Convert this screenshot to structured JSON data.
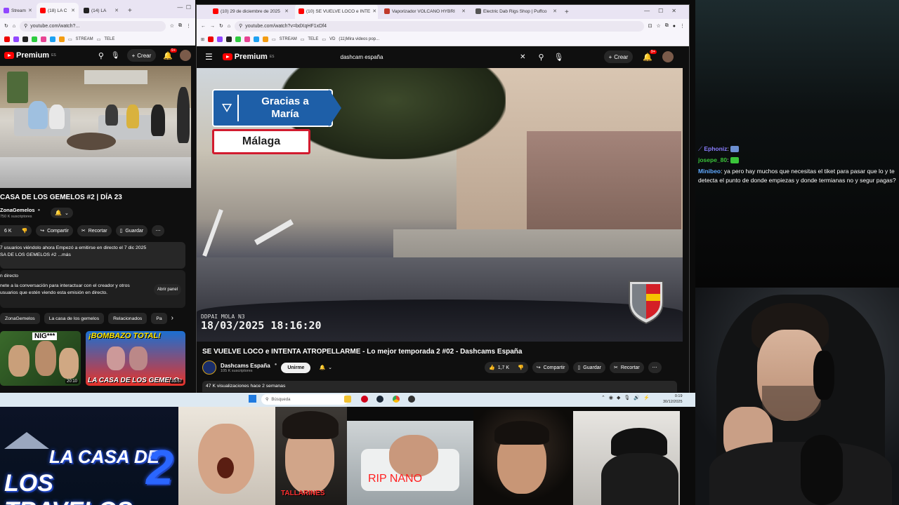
{
  "left_browser": {
    "tabs": [
      {
        "label": "Stream",
        "favicon_color": "#9146ff"
      },
      {
        "label": "(18) LA C",
        "favicon_color": "#ff0000"
      },
      {
        "label": "(14) LA",
        "favicon_color": "#222222"
      }
    ],
    "url": "youtube.com/watch?...",
    "bookmarks": [
      "STREAM",
      "TELE"
    ],
    "youtube": {
      "logo": "Premium",
      "logo_sup": "ES",
      "create_label": "Crear",
      "notif_count": "9+",
      "video_title": "CASA DE LOS GEMELOS #2 | DÍA 23",
      "channel": "ZonaGemelos",
      "subscribers": "750 K suscriptores",
      "likes": "6 K",
      "share_label": "Compartir",
      "clip_label": "Recortar",
      "save_label": "Guardar",
      "description_line1": "7 usuarios viéndolo ahora  Empezó a emitirse en directo el 7 dic 2025",
      "description_line2": "SA DE LOS GEMELOS #2 ...más",
      "live_heading": "n directo",
      "live_line1": "nete a la conversación para interactuar con el creador y otros",
      "live_line2": "usuarios que estén viendo esta emisión en directo.",
      "open_panel_label": "Abrir panel",
      "chips": [
        "ZonaGemelos",
        "La casa de los gemelos",
        "Relacionados",
        "Pa"
      ],
      "thumbs": [
        {
          "overlay_text": "NIG***",
          "duration": "20:10"
        },
        {
          "overlay_text": "¡BOMBAZO TOTAL!",
          "sub_text": "LA CASA DE LOS GEMELO",
          "duration": "33:57"
        }
      ]
    }
  },
  "right_browser": {
    "tabs": [
      {
        "label": "(10) 29 de diciembre de 2025",
        "favicon_color": "#ff0000"
      },
      {
        "label": "(10) SE VUELVE LOCO e INTE",
        "favicon_color": "#ff0000"
      },
      {
        "label": "Vaporizador VOLCANO HYBRI",
        "favicon_color": "#c0392b"
      },
      {
        "label": "Electric Dab Rigs Shop | Puffco",
        "favicon_color": "#555555"
      }
    ],
    "url": "youtube.com/watch?v=bdXqHF1xDf4",
    "bookmarks": [
      "STREAM",
      "TELE",
      "VD",
      "(11)Mira videos pop..."
    ],
    "youtube": {
      "logo": "Premium",
      "logo_sup": "ES",
      "search_value": "dashcam españa",
      "create_label": "Crear",
      "notif_count": "9+",
      "video_overlay": {
        "sign_line1": "Gracias a",
        "sign_line2": "María",
        "city_sign": "Málaga",
        "dashcam_brand": "DDPAI  MOLA N3",
        "timestamp": "18/03/2025 18:16:20"
      },
      "video_title": "SE VUELVE LOCO e INTENTA ATROPELLARME - Lo mejor temporada 2 #02 - Dashcams España",
      "channel": "Dashcams España",
      "subscribers": "105 K suscriptores",
      "join_label": "Unirme",
      "likes": "1,7 K",
      "share_label": "Compartir",
      "save_label": "Guardar",
      "clip_label": "Recortar",
      "views": "47 K visualizaciones  hace 2 semanas"
    }
  },
  "taskbar": {
    "search_placeholder": "Búsqueda",
    "time": "0:19",
    "date": "30/12/2025"
  },
  "chat": [
    {
      "user": "Ephoniz",
      "text": ""
    },
    {
      "user": "josepe_80",
      "text": ""
    },
    {
      "user": "Minibeo",
      "text": "ya pero hay muchos que necesitas el tiket para pasar que lo y te detecta el punto de donde empiezas y donde termianas no y segur pagas?"
    }
  ],
  "overlays": {
    "casa_line1": "LA CASA DE",
    "casa_line2": "LOS TRAVELOS",
    "casa_number": "2",
    "clip_label_1": "TALLARINES",
    "clip_label_2": "RIP NANO"
  },
  "colors": {
    "youtube_red": "#ff0000",
    "chat_user_1": "#8a7dff",
    "chat_user_2": "#3ac43a",
    "chat_user_3": "#5fa8ff"
  }
}
